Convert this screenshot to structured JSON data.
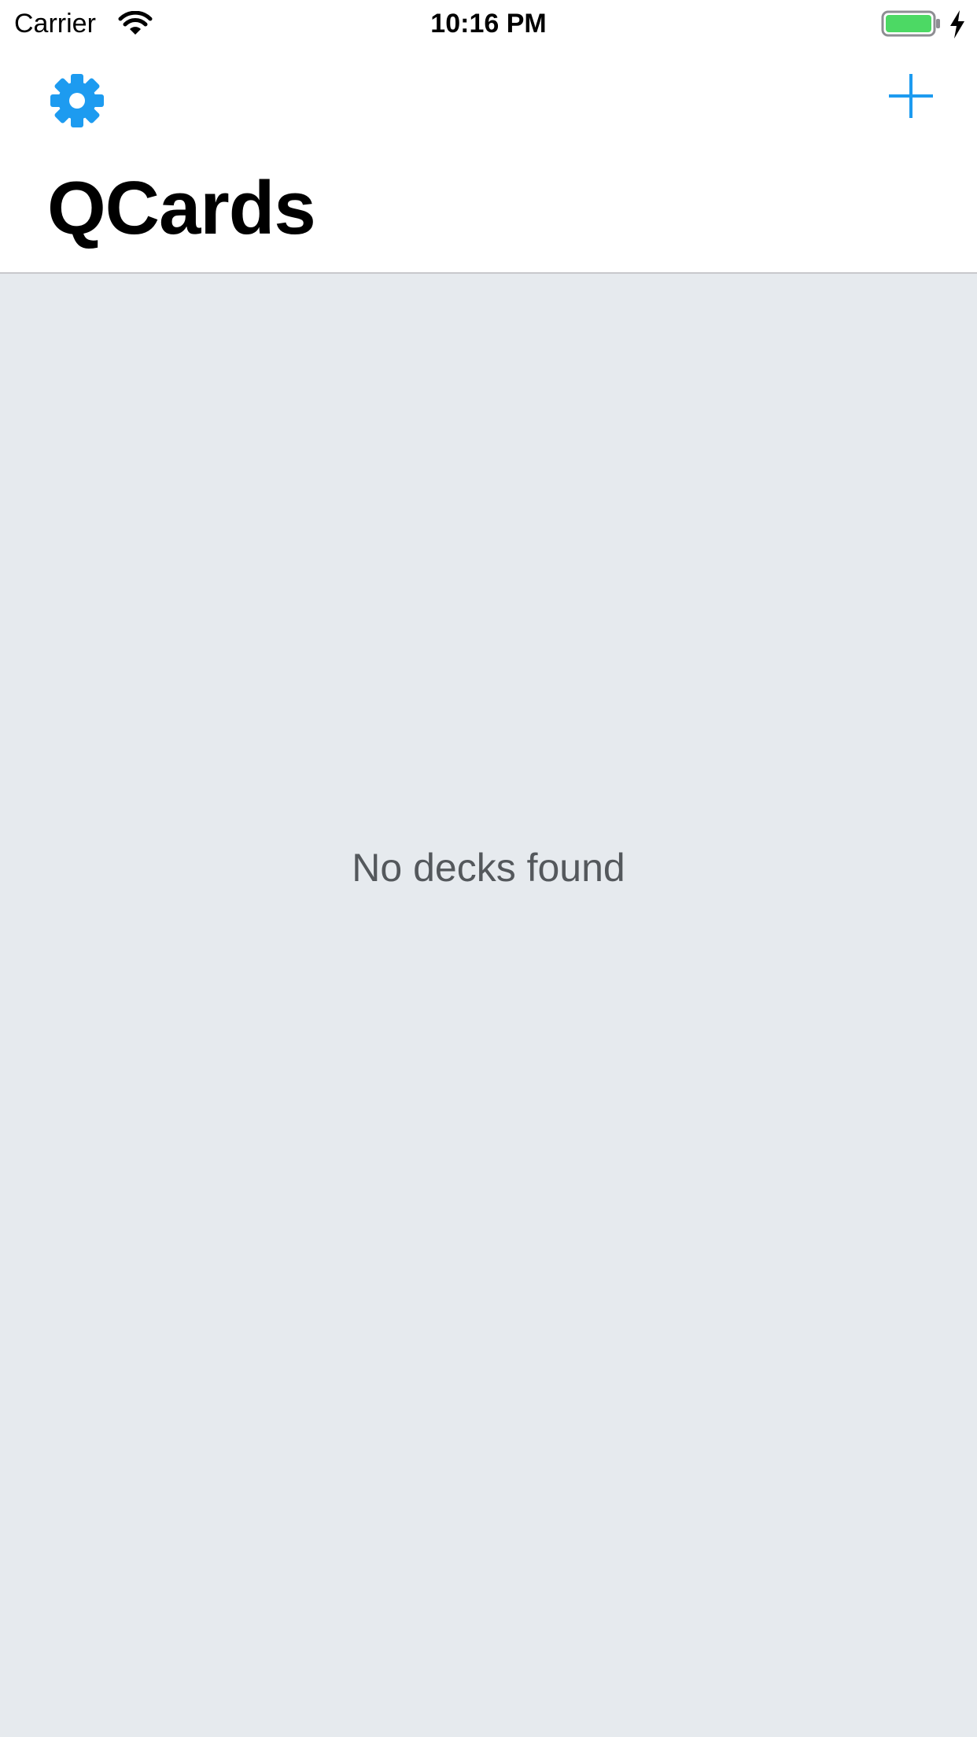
{
  "status_bar": {
    "carrier": "Carrier",
    "time": "10:16 PM",
    "icons": [
      "wifi-icon",
      "battery-icon",
      "charging-icon"
    ],
    "battery_color": "#4cd964"
  },
  "nav": {
    "title": "QCards",
    "left_icon": "gear-icon",
    "right_icon": "plus-icon",
    "accent_color": "#1d9bf0"
  },
  "content": {
    "empty_message": "No decks found",
    "background_color": "#e6eaee"
  }
}
